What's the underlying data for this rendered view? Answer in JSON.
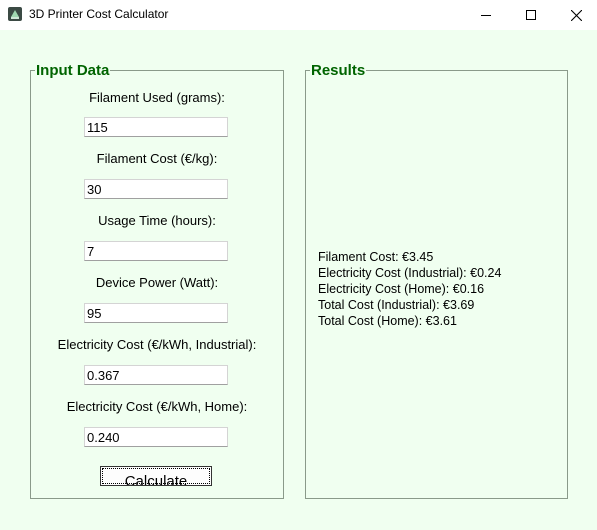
{
  "window": {
    "title": "3D Printer Cost Calculator",
    "icon": "3d-printer-icon"
  },
  "input_panel": {
    "heading": "Input Data",
    "fields": [
      {
        "label": "Filament Used (grams):",
        "value": "115"
      },
      {
        "label": "Filament Cost (€/kg):",
        "value": "30"
      },
      {
        "label": "Usage Time (hours):",
        "value": "7"
      },
      {
        "label": "Device Power (Watt):",
        "value": "95"
      },
      {
        "label": "Electricity Cost (€/kWh, Industrial):",
        "value": "0.367"
      },
      {
        "label": "Electricity Cost (€/kWh, Home):",
        "value": "0.240"
      }
    ],
    "calculate_label": "Calculate"
  },
  "results_panel": {
    "heading": "Results",
    "lines": [
      "Filament Cost: €3.45",
      "Electricity Cost (Industrial): €0.24",
      "Electricity Cost (Home): €0.16",
      "Total Cost (Industrial): €3.69",
      "Total Cost (Home): €3.61"
    ]
  },
  "colors": {
    "background": "#f0fff0",
    "heading": "#006400"
  }
}
